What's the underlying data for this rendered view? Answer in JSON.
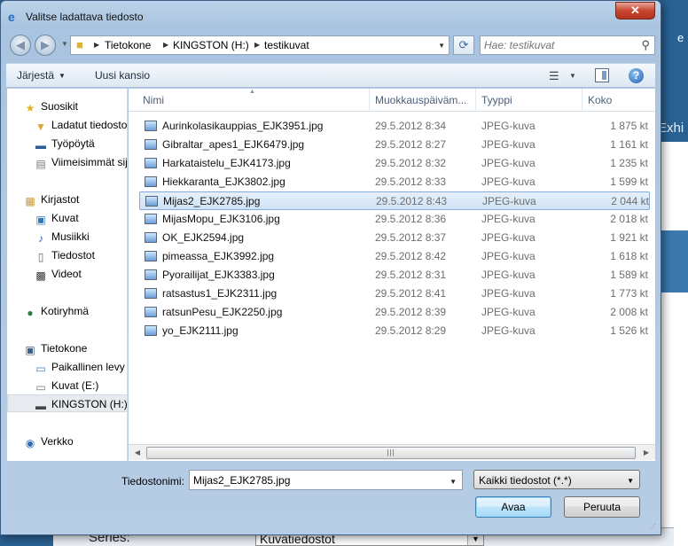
{
  "background": {
    "partial_text": "Exhi",
    "series_label": "Series:",
    "series_value": "Kuvatiedostot"
  },
  "window": {
    "title": "Valitse ladattava tiedosto",
    "close_glyph": "✕"
  },
  "navigation": {
    "breadcrumbs": [
      "Tietokone",
      "KINGSTON (H:)",
      "testikuvat"
    ],
    "search_placeholder": "Hae: testikuvat"
  },
  "toolbar": {
    "organize_label": "Järjestä",
    "new_folder_label": "Uusi kansio",
    "help_glyph": "?"
  },
  "sidebar": {
    "items": [
      {
        "label": "Suosikit",
        "icon": "star-icon"
      },
      {
        "label": "Ladatut tiedostot",
        "icon": "downloads-folder-icon"
      },
      {
        "label": "Työpöytä",
        "icon": "desktop-icon"
      },
      {
        "label": "Viimeisimmät sijainnit",
        "icon": "recent-places-icon"
      },
      {
        "label": "Kirjastot",
        "icon": "libraries-icon"
      },
      {
        "label": "Kuvat",
        "icon": "pictures-icon"
      },
      {
        "label": "Musiikki",
        "icon": "music-icon"
      },
      {
        "label": "Tiedostot",
        "icon": "documents-icon"
      },
      {
        "label": "Videot",
        "icon": "videos-icon"
      },
      {
        "label": "Kotiryhmä",
        "icon": "homegroup-icon"
      },
      {
        "label": "Tietokone",
        "icon": "computer-icon"
      },
      {
        "label": "Paikallinen levy (C:)",
        "icon": "local-disk-icon"
      },
      {
        "label": "Kuvat (E:)",
        "icon": "drive-icon"
      },
      {
        "label": "KINGSTON (H:)",
        "icon": "usb-drive-icon"
      },
      {
        "label": "Verkko",
        "icon": "network-icon"
      }
    ]
  },
  "columns": [
    "Nimi",
    "Muokkauspäiväm...",
    "Tyyppi",
    "Koko"
  ],
  "files": [
    {
      "name": "Aurinkolasikauppias_EJK3951.jpg",
      "date": "29.5.2012 8:34",
      "type": "JPEG-kuva",
      "size": "1 875 kt"
    },
    {
      "name": "Gibraltar_apes1_EJK6479.jpg",
      "date": "29.5.2012 8:27",
      "type": "JPEG-kuva",
      "size": "1 161 kt"
    },
    {
      "name": "Harkataistelu_EJK4173.jpg",
      "date": "29.5.2012 8:32",
      "type": "JPEG-kuva",
      "size": "1 235 kt"
    },
    {
      "name": "Hiekkaranta_EJK3802.jpg",
      "date": "29.5.2012 8:33",
      "type": "JPEG-kuva",
      "size": "1 599 kt"
    },
    {
      "name": "Mijas2_EJK2785.jpg",
      "date": "29.5.2012 8:43",
      "type": "JPEG-kuva",
      "size": "2 044 kt",
      "selected": true
    },
    {
      "name": "MijasMopu_EJK3106.jpg",
      "date": "29.5.2012 8:36",
      "type": "JPEG-kuva",
      "size": "2 018 kt"
    },
    {
      "name": "OK_EJK2594.jpg",
      "date": "29.5.2012 8:37",
      "type": "JPEG-kuva",
      "size": "1 921 kt"
    },
    {
      "name": "pimeassa_EJK3992.jpg",
      "date": "29.5.2012 8:42",
      "type": "JPEG-kuva",
      "size": "1 618 kt"
    },
    {
      "name": "Pyorailijat_EJK3383.jpg",
      "date": "29.5.2012 8:31",
      "type": "JPEG-kuva",
      "size": "1 589 kt"
    },
    {
      "name": "ratsastus1_EJK2311.jpg",
      "date": "29.5.2012 8:41",
      "type": "JPEG-kuva",
      "size": "1 773 kt"
    },
    {
      "name": "ratsunPesu_EJK2250.jpg",
      "date": "29.5.2012 8:39",
      "type": "JPEG-kuva",
      "size": "2 008 kt"
    },
    {
      "name": "yo_EJK2111.jpg",
      "date": "29.5.2012 8:29",
      "type": "JPEG-kuva",
      "size": "1 526 kt"
    }
  ],
  "footer": {
    "filename_label": "Tiedostonimi:",
    "filename_value": "Mijas2_EJK2785.jpg",
    "filetype_value": "Kaikki tiedostot (*.*)",
    "open_label": "Avaa",
    "cancel_label": "Peruuta"
  }
}
